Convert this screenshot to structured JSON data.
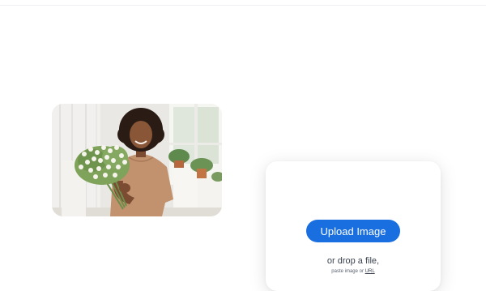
{
  "upload": {
    "button_label": "Upload Image",
    "drop_text": "or drop a file,",
    "paste_prefix": "paste image or",
    "url_link": "URL"
  },
  "colors": {
    "accent": "#1a6fe0",
    "text_dark": "#3b4350"
  },
  "icons": {
    "photo": "sample-photo"
  }
}
